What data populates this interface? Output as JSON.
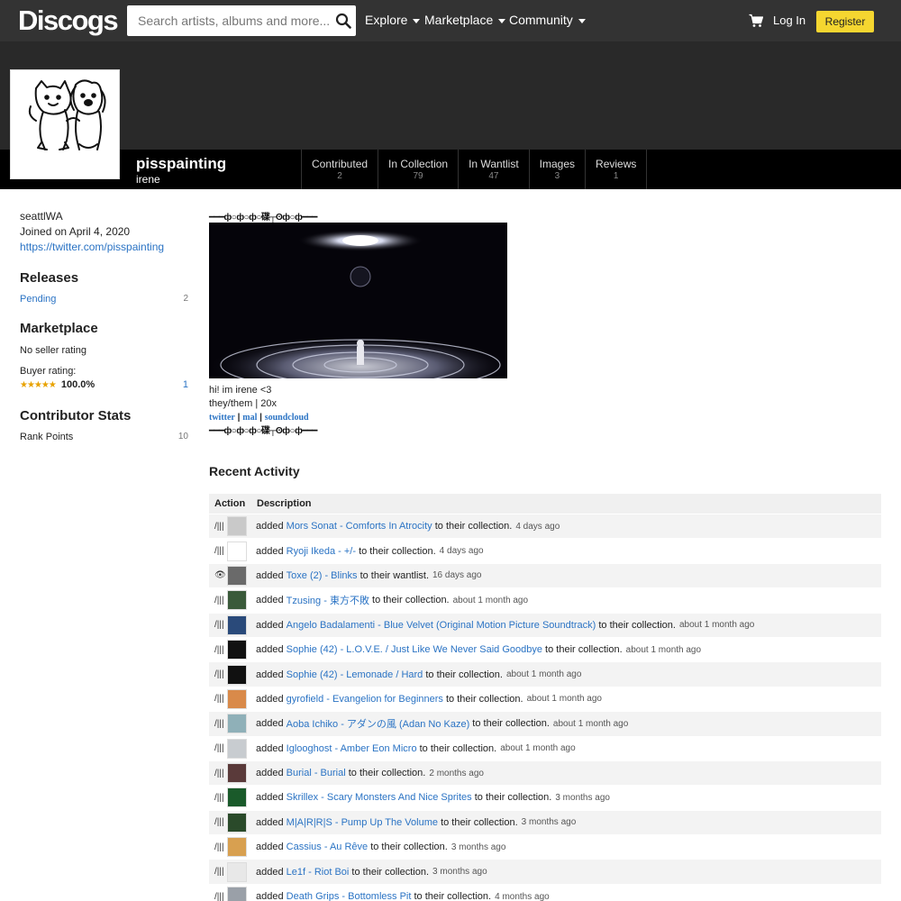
{
  "header": {
    "logo": "Discogs",
    "search_placeholder": "Search artists, albums and more...",
    "nav": [
      "Explore",
      "Marketplace",
      "Community"
    ],
    "login": "Log In",
    "register": "Register"
  },
  "profile": {
    "username": "pisspainting",
    "realname": "irene",
    "tabs": [
      {
        "label": "Contributed",
        "count": "2"
      },
      {
        "label": "In Collection",
        "count": "79"
      },
      {
        "label": "In Wantlist",
        "count": "47"
      },
      {
        "label": "Images",
        "count": "3"
      },
      {
        "label": "Reviews",
        "count": "1"
      }
    ]
  },
  "sidebar": {
    "location": "seattlWA",
    "joined": "Joined on April 4, 2020",
    "link": "https://twitter.com/pisspainting",
    "releases_title": "Releases",
    "pending_label": "Pending",
    "pending_count": "2",
    "marketplace_title": "Marketplace",
    "seller_rating": "No seller rating",
    "buyer_label": "Buyer rating:",
    "buyer_stars": "★★★★★",
    "buyer_value": "100.0%",
    "buyer_count": "1",
    "contrib_title": "Contributor Stats",
    "rank_label": "Rank Points",
    "rank_value": "10"
  },
  "main": {
    "deco": "━━━ф○ф○ф○碟┬ʘф○ф━━━",
    "bio_line1": "hi! im irene <3",
    "bio_line2": "they/them | 20x",
    "bio_links": [
      "twitter",
      "mal",
      "soundcloud"
    ],
    "bio_sep": " | ",
    "recent_title": "Recent Activity",
    "col_action": "Action",
    "col_description": "Description"
  },
  "activity": [
    {
      "icon": "/|||",
      "thumb": "#c9c9c9",
      "verb": "added",
      "release": "Mors Sonat - Comforts In Atrocity",
      "target": "to their collection.",
      "when": "4 days ago"
    },
    {
      "icon": "/|||",
      "thumb": "#ffffff",
      "verb": "added",
      "release": "Ryoji Ikeda - +/-",
      "target": "to their collection.",
      "when": "4 days ago"
    },
    {
      "icon": "👁",
      "thumb": "#6a6a6a",
      "verb": "added",
      "release": "Toxe (2) - Blinks",
      "target": "to their wantlist.",
      "when": "16 days ago"
    },
    {
      "icon": "/|||",
      "thumb": "#3a5a3a",
      "verb": "added",
      "release": "Tzusing - 東方不敗",
      "target": "to their collection.",
      "when": "about 1 month ago"
    },
    {
      "icon": "/|||",
      "thumb": "#2a4a7a",
      "verb": "added",
      "release": "Angelo Badalamenti - Blue Velvet (Original Motion Picture Soundtrack)",
      "target": "to their collection.",
      "when": "about 1 month ago"
    },
    {
      "icon": "/|||",
      "thumb": "#111111",
      "verb": "added",
      "release": "Sophie (42) - L.O.V.E. / Just Like We Never Said Goodbye",
      "target": "to their collection.",
      "when": "about 1 month ago"
    },
    {
      "icon": "/|||",
      "thumb": "#111111",
      "verb": "added",
      "release": "Sophie (42) - Lemonade / Hard",
      "target": "to their collection.",
      "when": "about 1 month ago"
    },
    {
      "icon": "/|||",
      "thumb": "#d98a4a",
      "verb": "added",
      "release": "gyrofield - Evangelion for Beginners",
      "target": "to their collection.",
      "when": "about 1 month ago"
    },
    {
      "icon": "/|||",
      "thumb": "#8fb0b8",
      "verb": "added",
      "release": "Aoba Ichiko - アダンの風 (Adan No Kaze)",
      "target": "to their collection.",
      "when": "about 1 month ago"
    },
    {
      "icon": "/|||",
      "thumb": "#c8ccd0",
      "verb": "added",
      "release": "Iglooghost - Amber Eon Micro",
      "target": "to their collection.",
      "when": "about 1 month ago"
    },
    {
      "icon": "/|||",
      "thumb": "#5a3a3a",
      "verb": "added",
      "release": "Burial - Burial",
      "target": "to their collection.",
      "when": "2 months ago"
    },
    {
      "icon": "/|||",
      "thumb": "#1a5a2a",
      "verb": "added",
      "release": "Skrillex - Scary Monsters And Nice Sprites",
      "target": "to their collection.",
      "when": "3 months ago"
    },
    {
      "icon": "/|||",
      "thumb": "#2a4a2a",
      "verb": "added",
      "release": "M|A|R|R|S - Pump Up The Volume",
      "target": "to their collection.",
      "when": "3 months ago"
    },
    {
      "icon": "/|||",
      "thumb": "#d8a050",
      "verb": "added",
      "release": "Cassius - Au Rêve",
      "target": "to their collection.",
      "when": "3 months ago"
    },
    {
      "icon": "/|||",
      "thumb": "#e8e8e8",
      "verb": "added",
      "release": "Le1f - Riot Boi",
      "target": "to their collection.",
      "when": "3 months ago"
    },
    {
      "icon": "/|||",
      "thumb": "#9aa0a8",
      "verb": "added",
      "release": "Death Grips - Bottomless Pit",
      "target": "to their collection.",
      "when": "4 months ago"
    }
  ]
}
